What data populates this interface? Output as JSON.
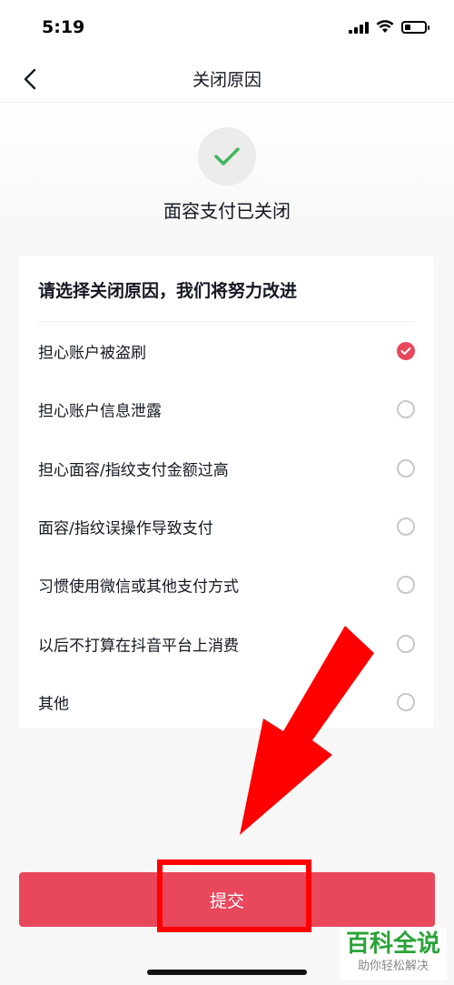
{
  "status_bar": {
    "time": "5:19",
    "battery_level": 0.3
  },
  "nav": {
    "title": "关闭原因",
    "back_icon": "chevron-left-icon"
  },
  "hero": {
    "icon": "checkmark-icon",
    "title": "面容支付已关闭"
  },
  "card": {
    "title": "请选择关闭原因，我们将努力改进",
    "reasons": [
      {
        "label": "担心账户被盗刷",
        "checked": true
      },
      {
        "label": "担心账户信息泄露",
        "checked": false
      },
      {
        "label": "担心面容/指纹支付金额过高",
        "checked": false
      },
      {
        "label": "面容/指纹误操作导致支付",
        "checked": false
      },
      {
        "label": "习惯使用微信或其他支付方式",
        "checked": false
      },
      {
        "label": "以后不打算在抖音平台上消费",
        "checked": false
      },
      {
        "label": "其他",
        "checked": false
      }
    ]
  },
  "submit": {
    "label": "提交"
  },
  "watermark": {
    "main": "百科全说",
    "sub": "助你轻松解决"
  },
  "colors": {
    "accent": "#e8475c",
    "check_green": "#3cb55a",
    "annotation_red": "#ff0000"
  }
}
